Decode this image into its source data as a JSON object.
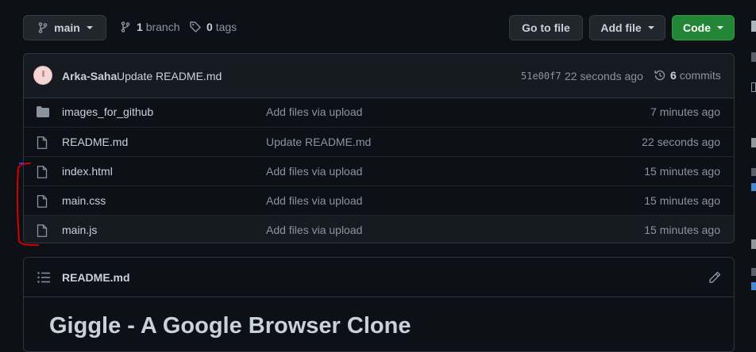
{
  "toolbar": {
    "branch_button": "main",
    "branches_count": "1",
    "branches_label": "branch",
    "tags_count": "0",
    "tags_label": "tags",
    "go_to_file": "Go to file",
    "add_file": "Add file",
    "code": "Code"
  },
  "commit": {
    "author": "Arka-Saha",
    "message": "Update README.md",
    "hash": "51e00f7",
    "time": "22 seconds ago",
    "commits_count": "6",
    "commits_label": "commits"
  },
  "files": [
    {
      "name": "images_for_github",
      "type": "folder",
      "message": "Add files via upload",
      "age": "7 minutes ago"
    },
    {
      "name": "README.md",
      "type": "file",
      "message": "Update README.md",
      "age": "22 seconds ago"
    },
    {
      "name": "index.html",
      "type": "file",
      "message": "Add files via upload",
      "age": "15 minutes ago"
    },
    {
      "name": "main.css",
      "type": "file",
      "message": "Add files via upload",
      "age": "15 minutes ago"
    },
    {
      "name": "main.js",
      "type": "file",
      "message": "Add files via upload",
      "age": "15 minutes ago"
    }
  ],
  "readme": {
    "filename": "README.md",
    "heading": "Giggle - A Google Browser Clone"
  },
  "colors": {
    "background": "#0d1117",
    "code_button": "#238636",
    "annotation": "#d40000"
  }
}
